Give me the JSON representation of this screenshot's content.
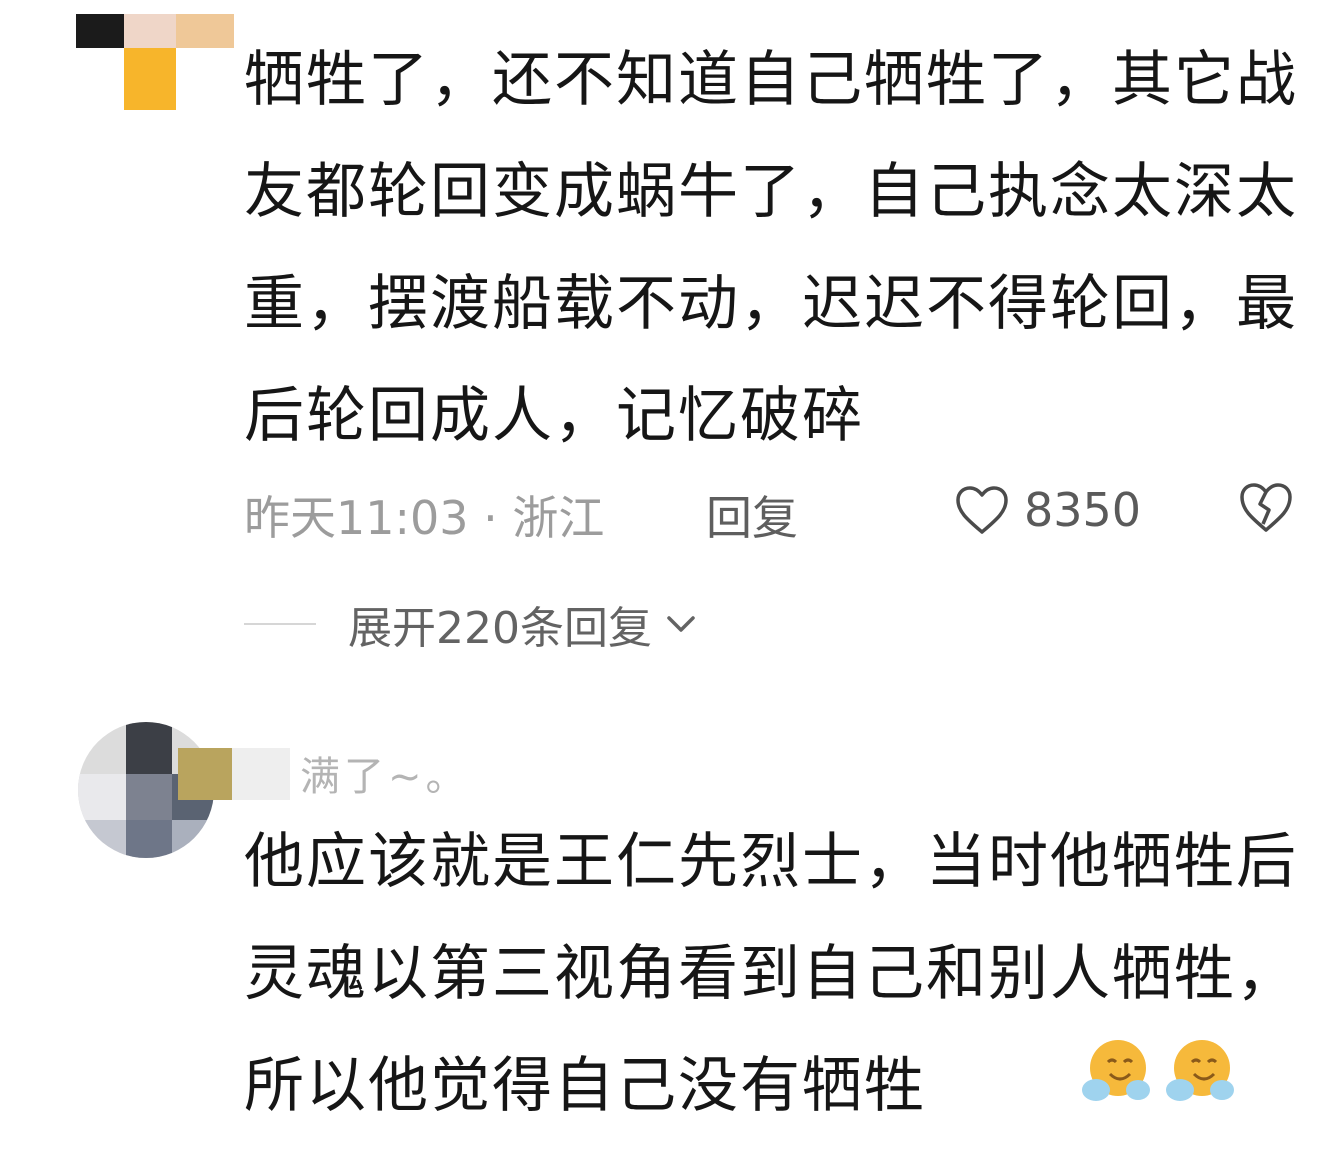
{
  "comments": [
    {
      "text": "牺牲了，还不知道自己牺牲了，其它战友都轮回变成蜗牛了，自己执念太深太重，摆渡船载不动，迟迟不得轮回，最后轮回成人，记忆破碎",
      "time_location": "昨天11:03 · 浙江",
      "reply_label": "回复",
      "like_count": "8350",
      "expand_label": "展开220条回复"
    },
    {
      "username": "满了~。",
      "text": "他应该就是王仁先烈士，当时他牺牲后灵魂以第三视角看到自己和别人牺牲，所以他觉得自己没有牺牲"
    }
  ],
  "icons": {
    "like": "heart-outline-icon",
    "dislike": "broken-heart-icon",
    "expand": "chevron-down-icon",
    "emoji": "hugging-face-emoji"
  },
  "colors": {
    "text": "#161616",
    "meta": "#9c9c9c",
    "emoji": "#f6b93b"
  }
}
